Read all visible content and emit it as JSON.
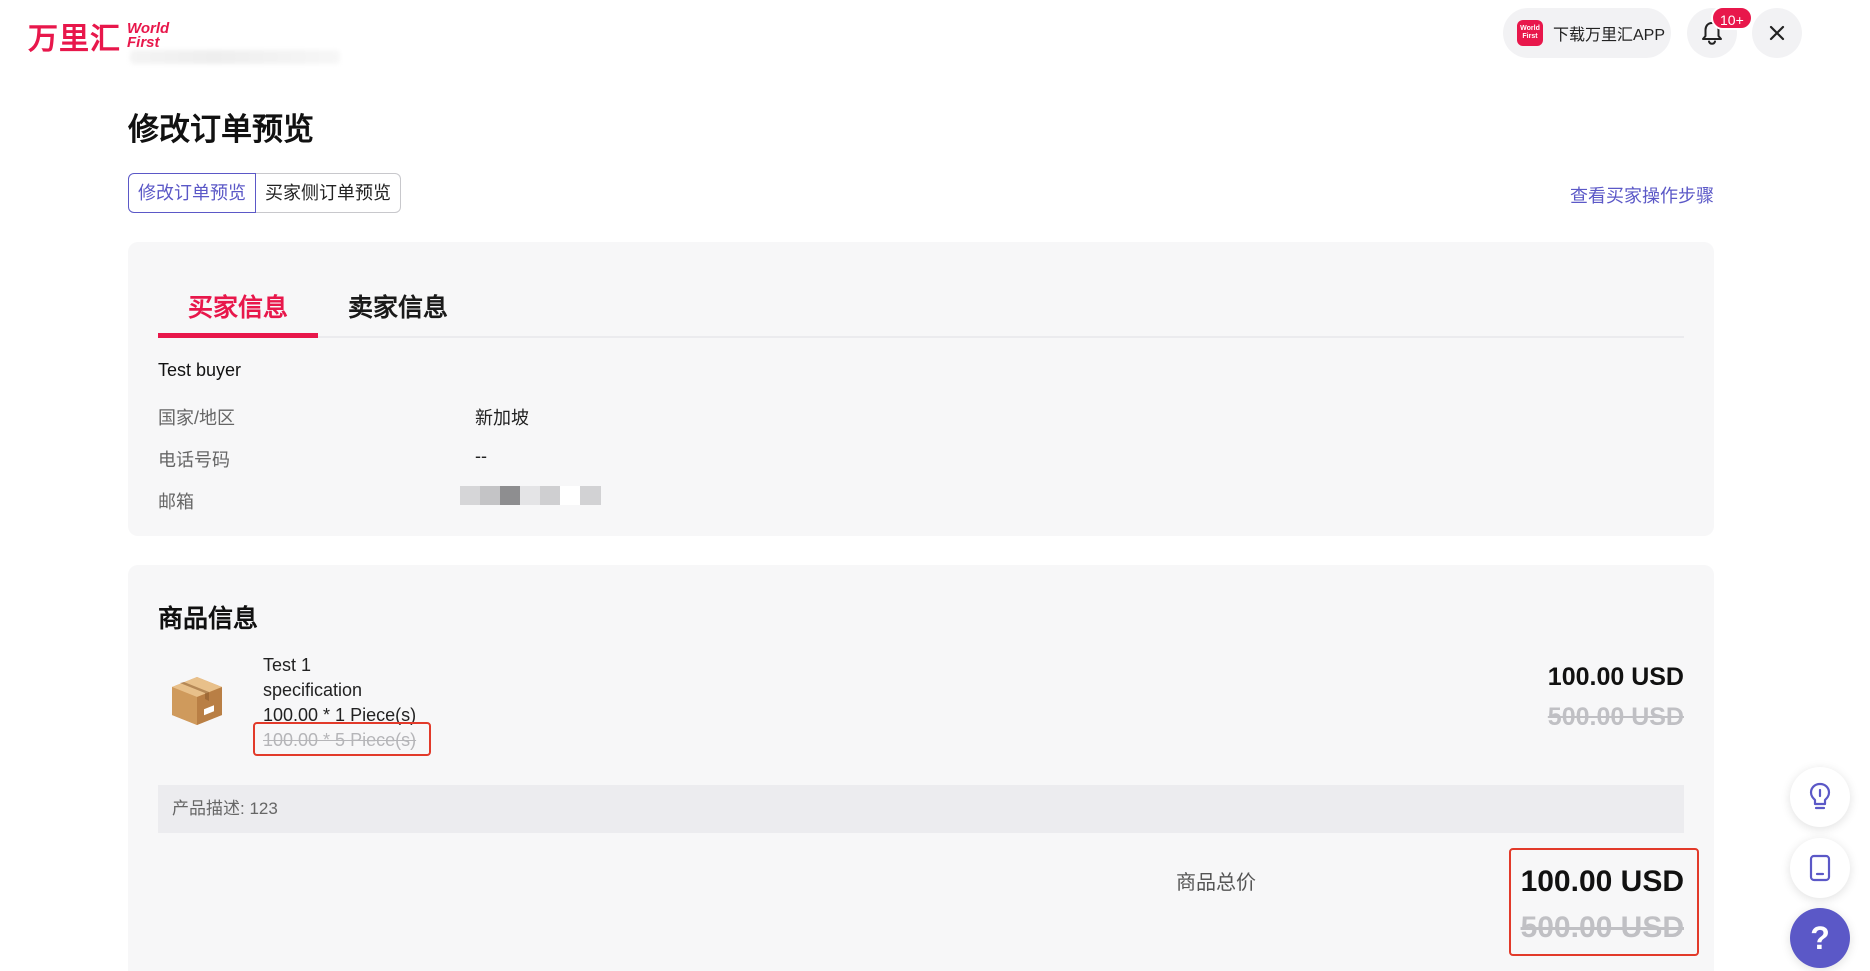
{
  "header": {
    "logo_cn": "万里汇",
    "logo_en_line1": "World",
    "logo_en_line2": "First",
    "app_icon_text": "World First",
    "download_app_label": "下载万里汇APP",
    "notification_badge": "10+"
  },
  "page": {
    "title": "修改订单预览",
    "segments": [
      "修改订单预览",
      "买家侧订单预览"
    ],
    "active_segment": "修改订单预览",
    "steps_link": "查看买家操作步骤"
  },
  "buyer_card": {
    "tabs": [
      "买家信息",
      "卖家信息"
    ],
    "active_tab": "买家信息",
    "buyer_name": "Test buyer",
    "rows": [
      {
        "label": "国家/地区",
        "value": "新加坡"
      },
      {
        "label": "电话号码",
        "value": "--"
      },
      {
        "label": "邮箱",
        "value": ""
      }
    ]
  },
  "product_card": {
    "title": "商品信息",
    "product_name": "Test 1",
    "specification": "specification",
    "qty_line": "100.00 * 1 Piece(s)",
    "qty_line_old": "100.00 * 5 Piece(s)",
    "price": "100.00 USD",
    "price_old": "500.00 USD",
    "description": "产品描述: 123",
    "total_label": "商品总价",
    "total": "100.00 USD",
    "total_old": "500.00 USD"
  },
  "colors": {
    "brand": "#e8174b",
    "accent": "#5b58c7",
    "highlight_box": "#e23a2a"
  }
}
